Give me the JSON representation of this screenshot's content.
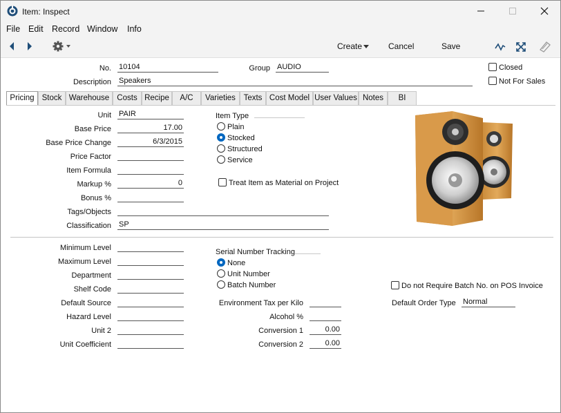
{
  "window": {
    "title": "Item: Inspect"
  },
  "menu": [
    "File",
    "Edit",
    "Record",
    "Window",
    "Info"
  ],
  "toolbar": {
    "create": "Create",
    "cancel": "Cancel",
    "save": "Save"
  },
  "header": {
    "no_label": "No.",
    "no_value": "10104",
    "group_label": "Group",
    "group_value": "AUDIO",
    "description_label": "Description",
    "description_value": "Speakers",
    "closed_label": "Closed",
    "not_for_sales_label": "Not For Sales"
  },
  "tabs": [
    "Pricing",
    "Stock",
    "Warehouse",
    "Costs",
    "Recipe",
    "A/C",
    "Varieties",
    "Texts",
    "Cost Model",
    "User Values",
    "Notes",
    "BI"
  ],
  "pricing": {
    "unit_label": "Unit",
    "unit_value": "PAIR",
    "base_price_label": "Base Price",
    "base_price_value": "17.00",
    "base_price_change_label": "Base Price Change",
    "base_price_change_value": "6/3/2015",
    "price_factor_label": "Price Factor",
    "price_factor_value": "",
    "item_formula_label": "Item Formula",
    "item_formula_value": "",
    "markup_label": "Markup %",
    "markup_value": "0",
    "bonus_label": "Bonus %",
    "bonus_value": "",
    "tags_label": "Tags/Objects",
    "tags_value": "",
    "classification_label": "Classification",
    "classification_value": "SP",
    "item_type_label": "Item Type",
    "item_type_options": [
      "Plain",
      "Stocked",
      "Structured",
      "Service"
    ],
    "item_type_selected": "Stocked",
    "treat_as_material_label": "Treat Item as Material on Project"
  },
  "lower": {
    "minimum_level_label": "Minimum Level",
    "maximum_level_label": "Maximum Level",
    "department_label": "Department",
    "shelf_code_label": "Shelf Code",
    "default_source_label": "Default Source",
    "hazard_level_label": "Hazard Level",
    "unit2_label": "Unit 2",
    "unit_coefficient_label": "Unit Coefficient",
    "serial_tracking_label": "Serial Number Tracking",
    "serial_options": [
      "None",
      "Unit Number",
      "Batch Number"
    ],
    "serial_selected": "None",
    "env_tax_label": "Environment Tax per Kilo",
    "alcohol_label": "Alcohol %",
    "conversion1_label": "Conversion 1",
    "conversion1_value": "0.00",
    "conversion2_label": "Conversion 2",
    "conversion2_value": "0.00",
    "no_batch_pos_label": "Do not Require Batch No. on POS Invoice",
    "default_order_type_label": "Default Order Type",
    "default_order_type_value": "Normal"
  },
  "icons": [
    "app-icon",
    "minimize-icon",
    "maximize-icon",
    "close-icon",
    "back-arrow-icon",
    "forward-arrow-icon",
    "gear-icon",
    "dropdown-arrow-icon",
    "activity-icon",
    "expand-icon",
    "attachment-icon",
    "speakers-image"
  ],
  "colors": {
    "accent": "#0067c0",
    "chrome": "#f3f3f3"
  }
}
